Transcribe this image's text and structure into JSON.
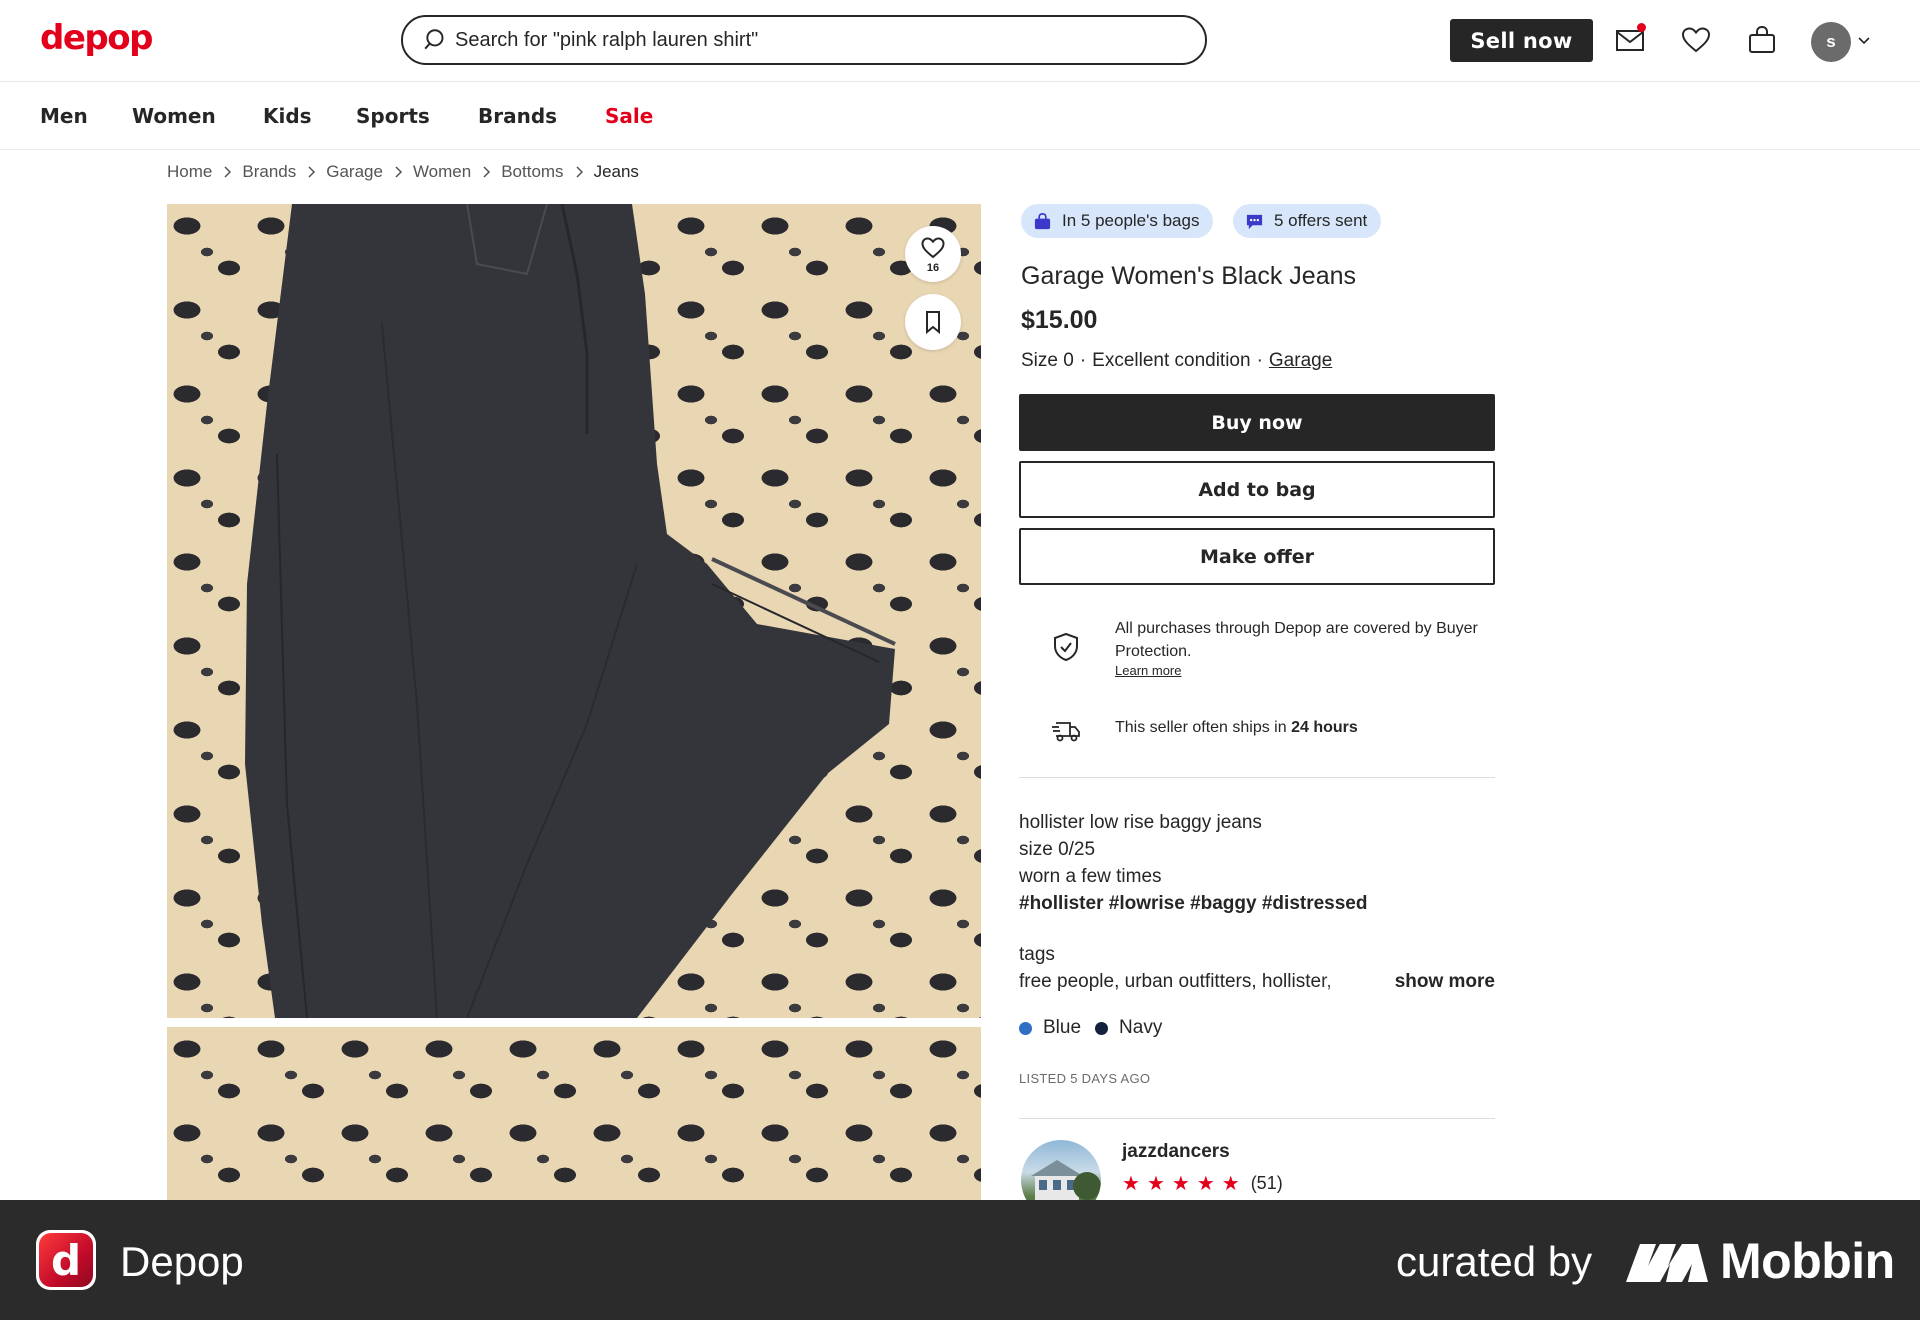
{
  "header": {
    "logo": "depop",
    "search_placeholder": "Search for \"pink ralph lauren shirt\"",
    "sell_label": "Sell now",
    "avatar_initial": "s"
  },
  "category_nav": [
    {
      "label": "Men"
    },
    {
      "label": "Women"
    },
    {
      "label": "Kids"
    },
    {
      "label": "Sports"
    },
    {
      "label": "Brands"
    },
    {
      "label": "Sale"
    }
  ],
  "breadcrumb": [
    "Home",
    "Brands",
    "Garage",
    "Women",
    "Bottoms",
    "Jeans"
  ],
  "gallery": {
    "favorite_count": "16"
  },
  "product": {
    "bags_pill": "In 5 people's bags",
    "offers_pill": "5 offers sent",
    "title": "Garage Women's Black Jeans",
    "price": "$15.00",
    "size": "Size 0",
    "condition": "Excellent condition",
    "brand": "Garage",
    "separator": "·",
    "buy_label": "Buy now",
    "add_to_bag_label": "Add to bag",
    "offer_label": "Make offer"
  },
  "protection": {
    "text": "All purchases through Depop are covered by Buyer Protection.",
    "learn_more": "Learn more",
    "ship_prefix": "This seller often ships in",
    "ship_time": "24 hours"
  },
  "description": {
    "lines": [
      "hollister low rise baggy jeans",
      "size 0/25",
      "worn a few times"
    ],
    "hashtags": "#hollister #lowrise #baggy #distressed",
    "tags_label": "tags",
    "tags_text": "free people, urban outfitters, hollister, ",
    "show_more": "show more"
  },
  "colors": [
    {
      "name": "Blue",
      "hex": "#2f6ec4"
    },
    {
      "name": "Navy",
      "hex": "#14213d"
    }
  ],
  "listed": "LISTED 5 DAYS AGO",
  "seller": {
    "username": "jazzdancers",
    "rating_stars": 5,
    "review_count": "(51)"
  },
  "footer": {
    "app_name": "Depop",
    "curated_by": "curated by",
    "brand": "Mobbin"
  },
  "theme": {
    "brand_red": "#e3001b",
    "pill_blue": "#d7e6fb",
    "dark": "#262626"
  }
}
